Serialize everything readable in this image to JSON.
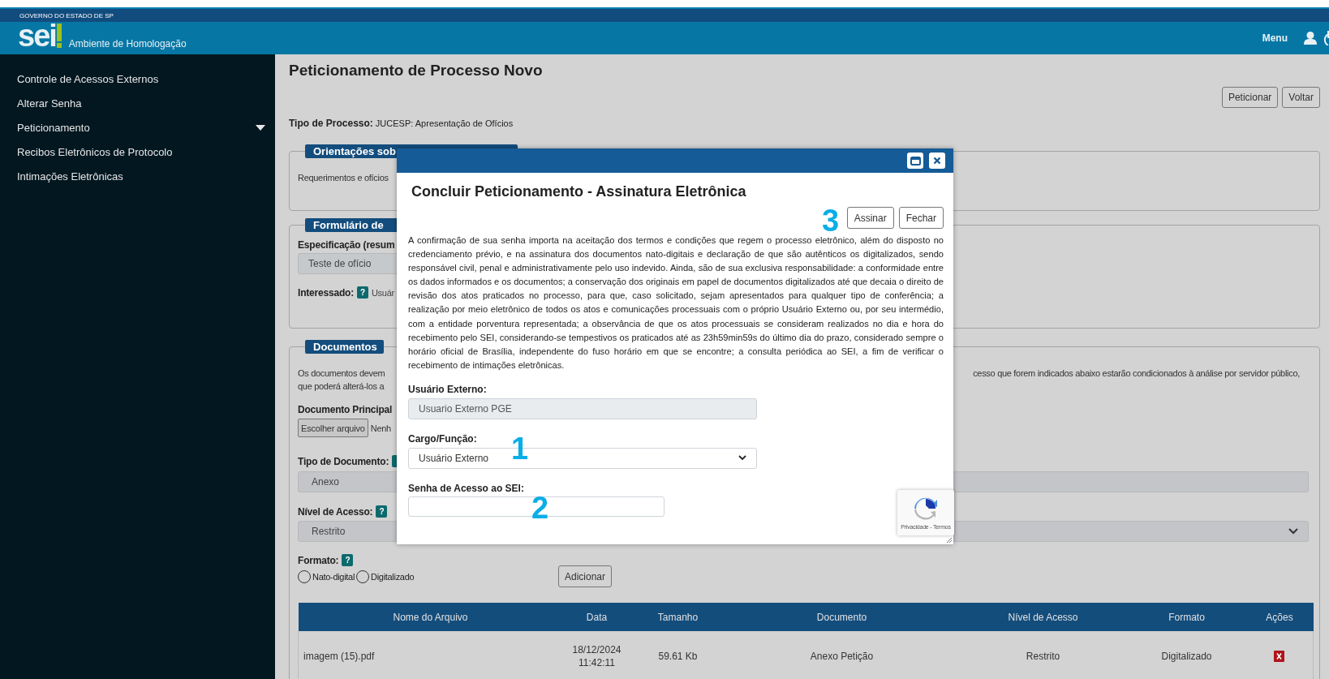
{
  "header": {
    "government": "GOVERNO DO ESTADO DE SP",
    "logo": "sei",
    "environment": "Ambiente de Homologação",
    "menu": "Menu"
  },
  "sidebar": {
    "items": [
      {
        "label": "Controle de Acessos Externos",
        "expandable": false
      },
      {
        "label": "Alterar Senha",
        "expandable": false
      },
      {
        "label": "Peticionamento",
        "expandable": true
      },
      {
        "label": "Recibos Eletrônicos de Protocolo",
        "expandable": false
      },
      {
        "label": "Intimações Eletrônicas",
        "expandable": false
      }
    ]
  },
  "page": {
    "title": "Peticionamento de Processo Novo",
    "buttons": [
      "Peticionar",
      "Voltar"
    ],
    "process_type_label": "Tipo de Processo:",
    "process_type": "JUCESP: Apresentação de Ofícios",
    "orientation": {
      "legend": "Orientações sob",
      "text": "Requerimentos e ofícios"
    },
    "form": {
      "legend": "Formulário de",
      "specification_label": "Especificação (resum",
      "specification_value": "Teste de ofício",
      "interested_label": "Interessado:",
      "interested_help": "?",
      "interested_value": "Usuár"
    },
    "documents": {
      "legend": "Documentos",
      "intro_left": [
        "Os documentos devem",
        "que poderá alterá-los a"
      ],
      "intro_right": "cesso que forem indicados abaixo estarão condicionados à análise por servidor público,",
      "main_document_label": "Documento Principal",
      "file_button": "Escolher arquivo",
      "file_status": "Nenh",
      "document_type_label": "Tipo de Documento:",
      "document_type": "Anexo",
      "access_level_label": "Nível de Acesso:",
      "access_level_help": "?",
      "access_level": "Restrito",
      "format_label": "Formato:",
      "format_help": "?",
      "formats": [
        {
          "label": "Nato-digital",
          "selected": false
        },
        {
          "label": "Digitalizado",
          "selected": false
        }
      ],
      "add_button": "Adicionar",
      "table": {
        "columns": [
          "Nome do Arquivo",
          "Data",
          "Tamanho",
          "Documento",
          "Nível de Acesso",
          "Formato",
          "Ações"
        ],
        "rows": [
          {
            "cells": [
              "imagem (15).pdf",
              "18/12/2024 11:42:11",
              "59.61 Kb",
              "Anexo Petição",
              "Restrito",
              "Digitalizado"
            ]
          }
        ]
      }
    }
  },
  "modal": {
    "title": "Concluir Peticionamento - Assinatura Eletrônica",
    "buttons": [
      "Assinar",
      "Fechar"
    ],
    "terms": "A confirmação de sua senha importa na aceitação dos termos e condições que regem o processo eletrônico, além do disposto no credenciamento prévio, e na assinatura dos documentos nato-digitais e declaração de que são autênticos os digitalizados, sendo responsável civil, penal e administrativamente pelo uso indevido. Ainda, são de sua exclusiva responsabilidade: a conformidade entre os dados informados e os documentos; a conservação dos originais em papel de documentos digitalizados até que decaia o direito de revisão dos atos praticados no processo, para que, caso solicitado, sejam apresentados para qualquer tipo de conferência; a realização por meio eletrônico de todos os atos e comunicações processuais com o próprio Usuário Externo ou, por seu intermédio, com a entidade porventura representada; a observância de que os atos processuais se consideram realizados no dia e hora do recebimento pelo SEI, considerando-se tempestivos os praticados até as 23h59min59s do último dia do prazo, considerado sempre o horário oficial de Brasília, independente do fuso horário em que se encontre; a consulta periódica ao SEI, a fim de verificar o recebimento de intimações eletrônicas.",
    "user_label": "Usuário Externo:",
    "user_value": "Usuario Externo PGE",
    "role_label": "Cargo/Função:",
    "role_value": "Usuário Externo",
    "password_label": "Senha de Acesso ao SEI:",
    "captcha": "Privacidade - Termos",
    "annotations": [
      "3",
      "1",
      "2"
    ]
  }
}
